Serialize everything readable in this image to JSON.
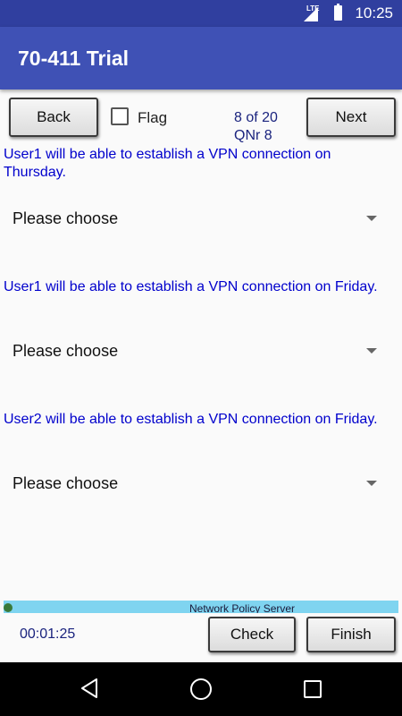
{
  "status_bar": {
    "time": "10:25",
    "network": "LTE"
  },
  "app_bar": {
    "title": "70-411 Trial"
  },
  "toolbar": {
    "back_label": "Back",
    "flag_label": "Flag",
    "position": "8 of 20",
    "question_number": "QNr  8",
    "next_label": "Next"
  },
  "questions": [
    {
      "text": "User1 will be able to establish a VPN connection on Thursday.",
      "selected": "Please choose"
    },
    {
      "text": "User1 will be able to establish a VPN connection on Friday.",
      "selected": "Please choose"
    },
    {
      "text": "User2 will be able to establish a VPN connection on Friday.",
      "selected": "Please choose"
    }
  ],
  "banner": {
    "text": "Network Policy Server"
  },
  "footer": {
    "timer": "00:01:25",
    "check_label": "Check",
    "finish_label": "Finish"
  }
}
